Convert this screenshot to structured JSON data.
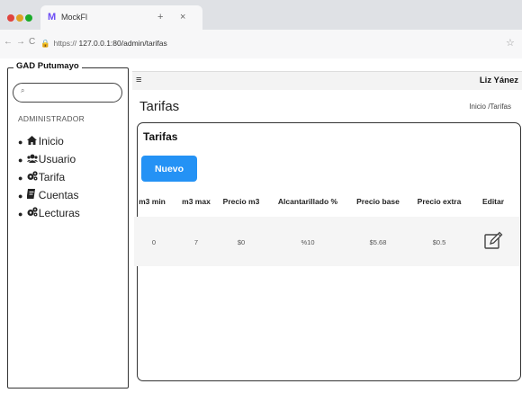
{
  "browser": {
    "tab_logo": "M",
    "tab_title": "MockFl",
    "new_tab": "+",
    "close_tab": "×",
    "url_protocol": "https://",
    "url_rest": "127.0.0.1:80/admin/tarifas",
    "back": "←",
    "forward": "→",
    "reload": "C",
    "lock": "🔒",
    "bookmark": "☆"
  },
  "sidebar": {
    "title": "GAD Putumayo",
    "search_icon": "⌕",
    "section": "ADMINISTRADOR",
    "items": [
      {
        "label": "Inicio",
        "icon": "home-icon"
      },
      {
        "label": "Usuario",
        "icon": "users-icon"
      },
      {
        "label": "Tarifa",
        "icon": "gears-icon"
      },
      {
        "label": "Cuentas",
        "icon": "document-icon"
      },
      {
        "label": "Lecturas",
        "icon": "gears-icon"
      }
    ]
  },
  "topbar": {
    "menu_icon": "≡",
    "user": "Liz Yánez"
  },
  "page": {
    "title": "Tarifas",
    "breadcrumb": "Inicio /Tarifas"
  },
  "card": {
    "title": "Tarifas",
    "new_button": "Nuevo",
    "columns": [
      "m3 min",
      "m3 max",
      "Precio m3",
      "Alcantarillado %",
      "Precio base",
      "Precio extra",
      "Editar"
    ],
    "rows": [
      {
        "m3_min": "0",
        "m3_max": "7",
        "precio_m3": "$0",
        "alcantarillado": "%10",
        "precio_base": "$5.68",
        "precio_extra": "$0.5"
      }
    ]
  },
  "colors": {
    "accent": "#2492f5",
    "tab_logo": "#6c4cf5"
  }
}
